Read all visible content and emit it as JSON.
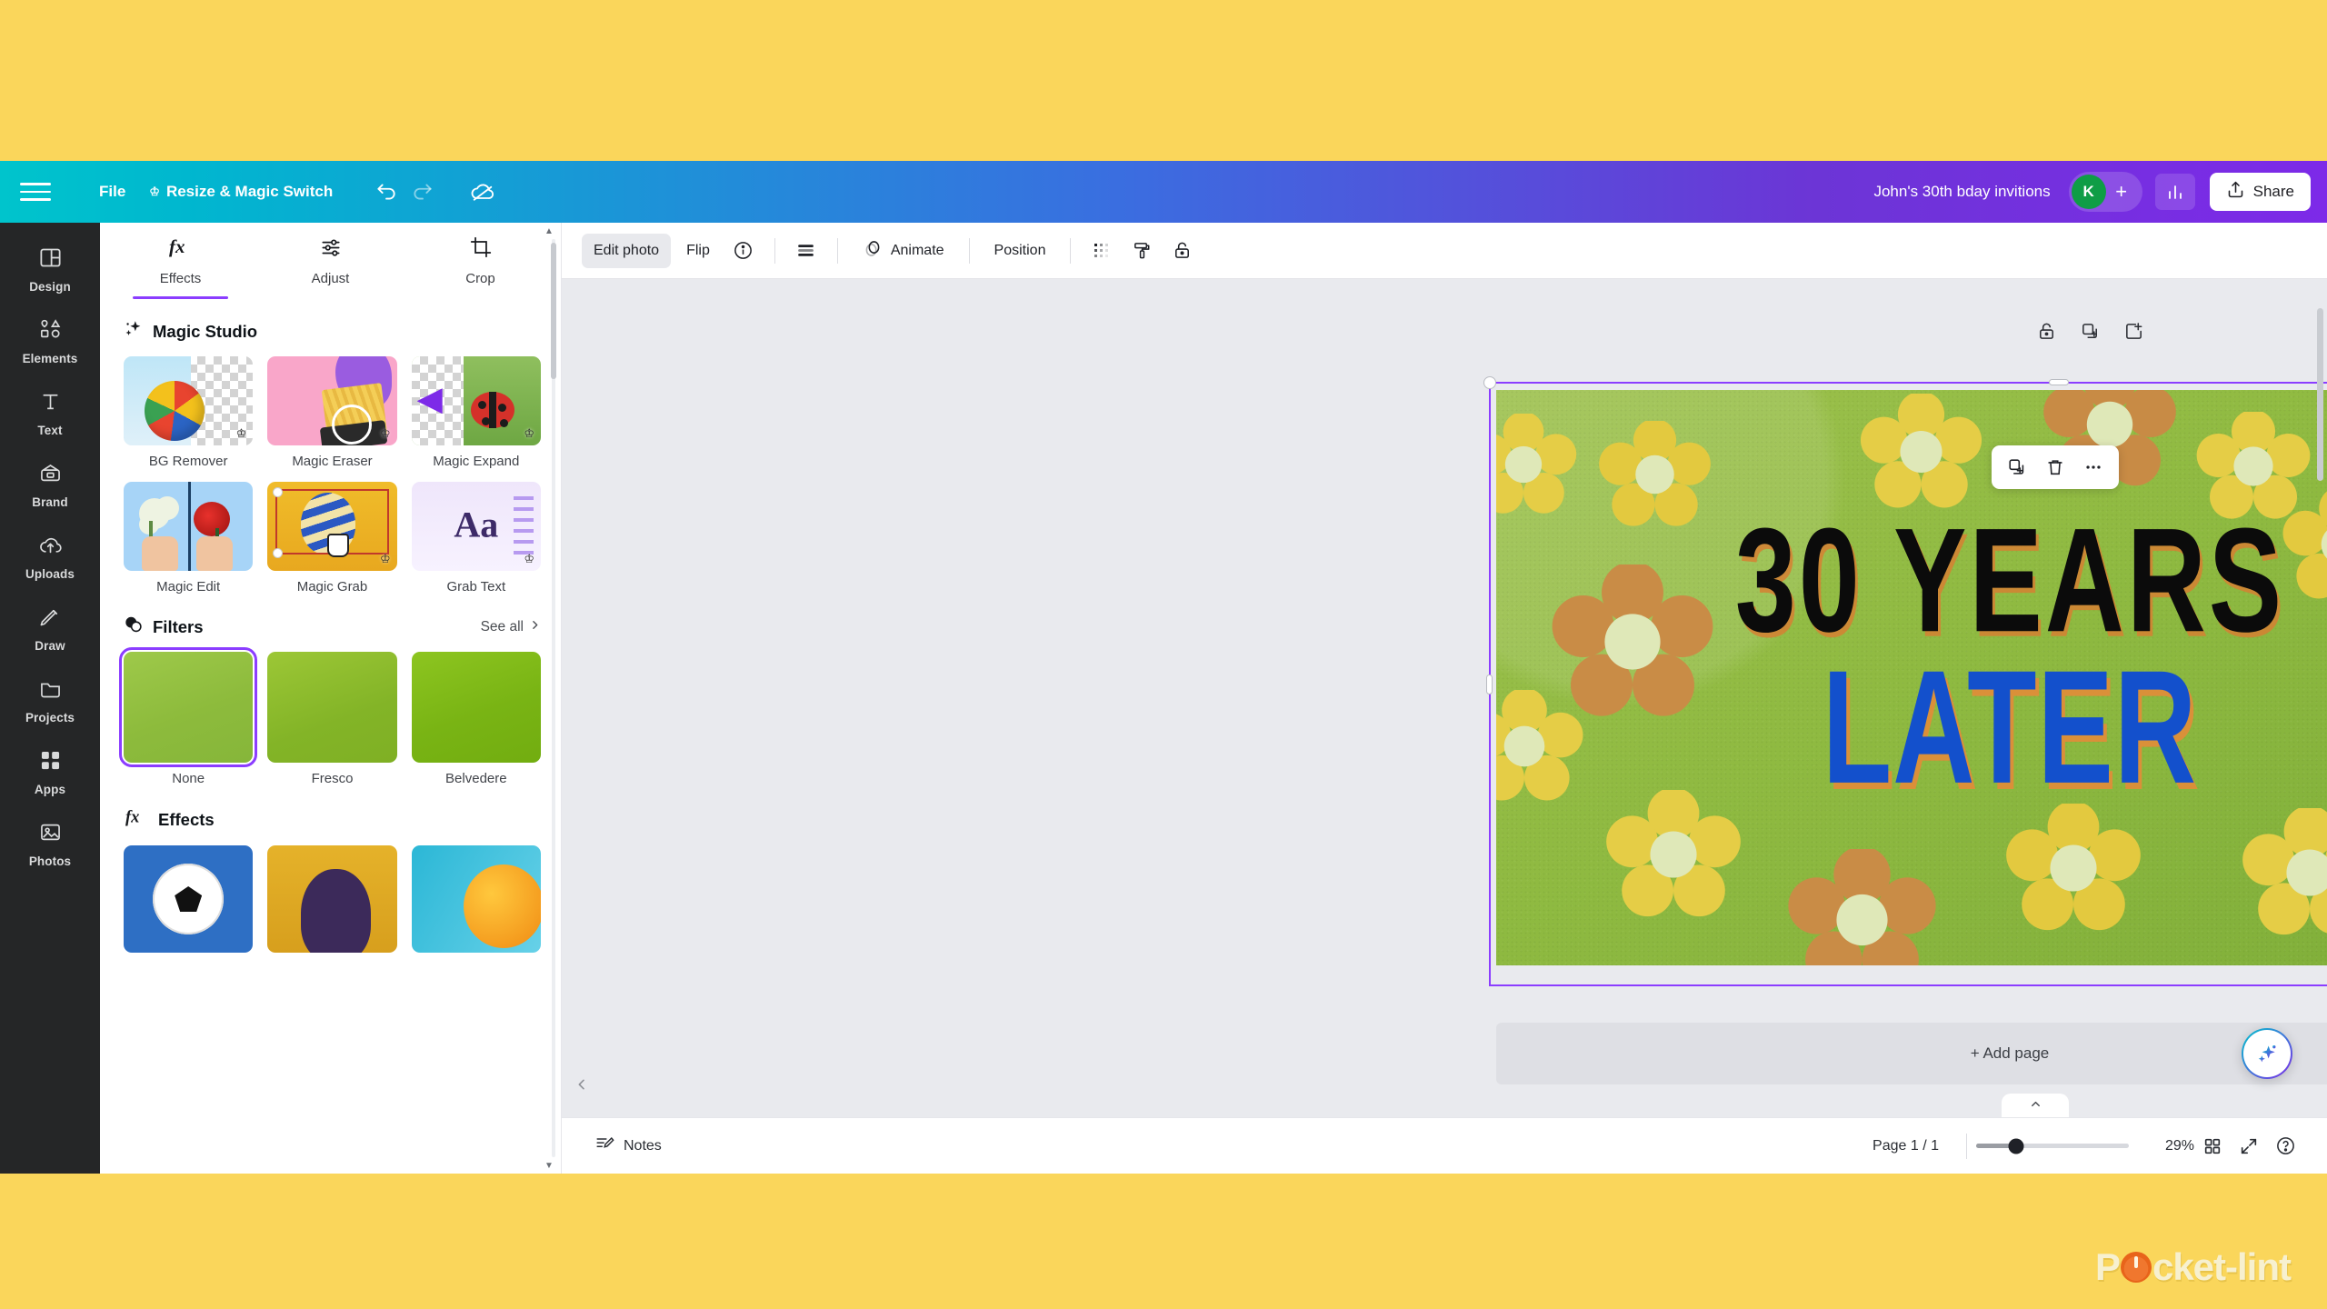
{
  "topbar": {
    "menu_icon": "hamburger-icon",
    "file_label": "File",
    "resize_label": "Resize & Magic Switch",
    "undo_icon": "undo-icon",
    "redo_icon": "redo-icon",
    "cloud_icon": "cloud-sync-icon",
    "doc_title": "John's 30th bday invitions",
    "avatar_initial": "K",
    "add_collaborator": "+",
    "stats_icon": "insights-icon",
    "share_label": "Share",
    "share_icon": "share-upload-icon"
  },
  "rail": {
    "items": [
      {
        "label": "Design",
        "icon": "design-layout-icon"
      },
      {
        "label": "Elements",
        "icon": "shapes-icon"
      },
      {
        "label": "Text",
        "icon": "text-t-icon"
      },
      {
        "label": "Brand",
        "icon": "brand-kit-icon"
      },
      {
        "label": "Uploads",
        "icon": "cloud-upload-icon"
      },
      {
        "label": "Draw",
        "icon": "pen-draw-icon"
      },
      {
        "label": "Projects",
        "icon": "folder-projects-icon"
      },
      {
        "label": "Apps",
        "icon": "apps-grid-icon"
      },
      {
        "label": "Photos",
        "icon": "photos-image-icon"
      }
    ]
  },
  "panel": {
    "tabs": [
      {
        "label": "Effects",
        "icon": "fx-icon",
        "active": true
      },
      {
        "label": "Adjust",
        "icon": "sliders-icon",
        "active": false
      },
      {
        "label": "Crop",
        "icon": "crop-icon",
        "active": false
      }
    ],
    "magic_studio": {
      "title": "Magic Studio",
      "icon": "sparkle-icon",
      "items": [
        {
          "label": "BG Remover",
          "pro": true
        },
        {
          "label": "Magic Eraser",
          "pro": true
        },
        {
          "label": "Magic Expand",
          "pro": true
        },
        {
          "label": "Magic Edit",
          "pro": false
        },
        {
          "label": "Magic Grab",
          "pro": true
        },
        {
          "label": "Grab Text",
          "pro": true
        }
      ]
    },
    "filters": {
      "title": "Filters",
      "icon": "filters-circles-icon",
      "see_all": "See all",
      "see_all_icon": "chevron-right-icon",
      "items": [
        {
          "label": "None",
          "selected": true
        },
        {
          "label": "Fresco",
          "selected": false
        },
        {
          "label": "Belvedere",
          "selected": false
        }
      ]
    },
    "effects": {
      "title": "Effects",
      "icon": "fx-icon",
      "items": [
        {
          "label": ""
        },
        {
          "label": ""
        },
        {
          "label": ""
        }
      ]
    }
  },
  "context_toolbar": {
    "edit_photo": "Edit photo",
    "flip": "Flip",
    "info_icon": "info-circle-icon",
    "transparency_icon": "transparency-bars-icon",
    "animate_label": "Animate",
    "animate_icon": "animate-circle-icon",
    "position_label": "Position",
    "spacing_icon": "dither-grid-icon",
    "paint_icon": "paint-roller-icon",
    "lock_icon": "lock-open-icon"
  },
  "canvas": {
    "page_icons": [
      {
        "icon": "lock-open-icon"
      },
      {
        "icon": "duplicate-page-icon"
      },
      {
        "icon": "add-page-icon"
      }
    ],
    "floating_toolbar": [
      {
        "icon": "duplicate-icon"
      },
      {
        "icon": "trash-icon"
      },
      {
        "icon": "more-dots-icon"
      }
    ],
    "comment_icon": "comment-add-icon",
    "rotate_icon": "rotate-icon",
    "add_page_label": "+ Add page",
    "collapse_icon": "chevron-up-icon",
    "scroll_left_icon": "chevron-left-icon",
    "ai_icon": "magic-sparkle-icon",
    "design": {
      "line1": "30 YEARS",
      "line2": "LATER",
      "bg_color": "#8fba41",
      "line1_color": "#0b0b0b",
      "line2_color": "#1350cc"
    }
  },
  "statusbar": {
    "notes_label": "Notes",
    "notes_icon": "notes-icon",
    "page_indicator": "Page 1 / 1",
    "zoom_value": "29%",
    "grid_icon": "grid-view-icon",
    "fullscreen_icon": "expand-icon",
    "help_icon": "help-circle-icon"
  },
  "watermark": {
    "prefix": "P",
    "suffix": "cket-lint"
  },
  "colors": {
    "brand_teal": "#00c4cc",
    "brand_purple": "#7d2ae8",
    "accent_purple": "#8b3dff",
    "avatar_green": "#0f9d46",
    "page_bg": "#FAD65B"
  }
}
